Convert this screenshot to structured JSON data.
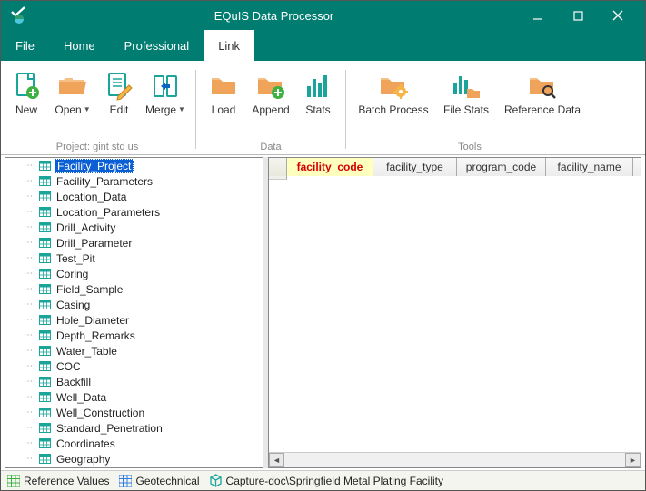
{
  "window": {
    "title": "EQuIS Data Processor"
  },
  "menu": {
    "file": "File",
    "home": "Home",
    "professional": "Professional",
    "link": "Link"
  },
  "ribbon": {
    "group_project_label": "Project: gint std us",
    "group_data_label": "Data",
    "group_tools_label": "Tools",
    "new": "New",
    "open": "Open",
    "edit": "Edit",
    "merge": "Merge",
    "load": "Load",
    "append": "Append",
    "stats": "Stats",
    "batch_process": "Batch Process",
    "file_stats": "File Stats",
    "reference_data": "Reference Data"
  },
  "tree": {
    "items": [
      "Facility_Project",
      "Facility_Parameters",
      "Location_Data",
      "Location_Parameters",
      "Drill_Activity",
      "Drill_Parameter",
      "Test_Pit",
      "Coring",
      "Field_Sample",
      "Casing",
      "Hole_Diameter",
      "Depth_Remarks",
      "Water_Table",
      "COC",
      "Backfill",
      "Well_Data",
      "Well_Construction",
      "Standard_Penetration",
      "Coordinates",
      "Geography"
    ]
  },
  "grid": {
    "columns": [
      "facility_code",
      "facility_type",
      "program_code",
      "facility_name"
    ]
  },
  "status": {
    "ref_values": "Reference Values",
    "geotechnical": "Geotechnical",
    "capture": "Capture-doc\\Springfield Metal Plating Facility"
  }
}
